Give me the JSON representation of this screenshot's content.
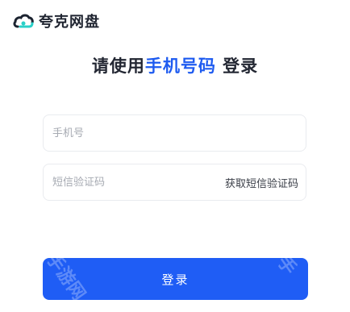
{
  "app": {
    "brand_name": "夸克网盘"
  },
  "headline": {
    "prefix": "请使用",
    "accent": "手机号码",
    "suffix": " 登录"
  },
  "form": {
    "phone_placeholder": "手机号",
    "code_placeholder": "短信验证码",
    "get_code_label": "获取短信验证码",
    "submit_label": "登录"
  },
  "watermark": {
    "text_left": "手游网",
    "text_right": "手"
  },
  "colors": {
    "accent": "#1e5bf0",
    "button": "#1f5df5",
    "logo_dark": "#1c2330",
    "logo_teal": "#2ad0c8"
  }
}
